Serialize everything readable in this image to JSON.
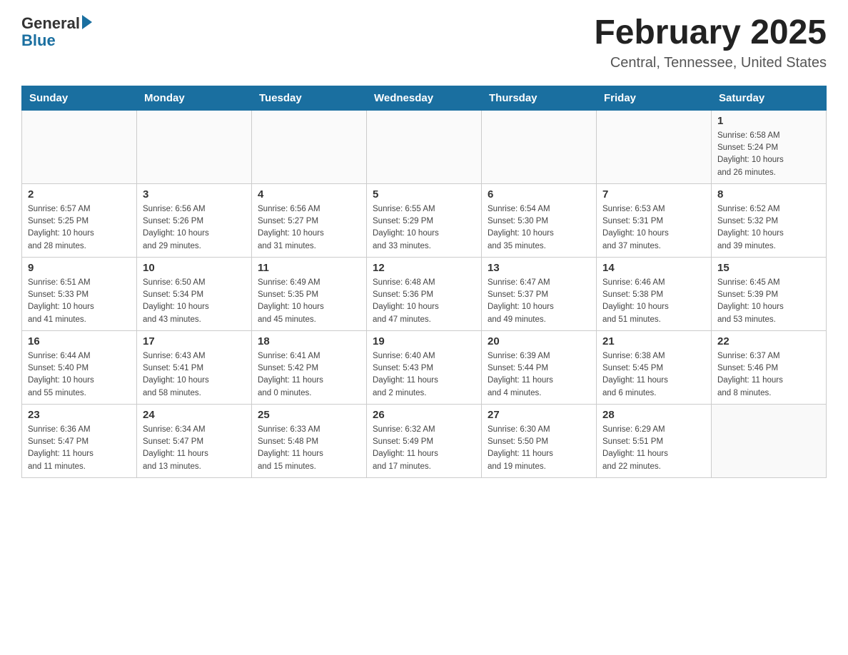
{
  "header": {
    "logo_general": "General",
    "logo_blue": "Blue",
    "month_title": "February 2025",
    "location": "Central, Tennessee, United States"
  },
  "days_of_week": [
    "Sunday",
    "Monday",
    "Tuesday",
    "Wednesday",
    "Thursday",
    "Friday",
    "Saturday"
  ],
  "weeks": [
    [
      {
        "day": "",
        "info": ""
      },
      {
        "day": "",
        "info": ""
      },
      {
        "day": "",
        "info": ""
      },
      {
        "day": "",
        "info": ""
      },
      {
        "day": "",
        "info": ""
      },
      {
        "day": "",
        "info": ""
      },
      {
        "day": "1",
        "info": "Sunrise: 6:58 AM\nSunset: 5:24 PM\nDaylight: 10 hours\nand 26 minutes."
      }
    ],
    [
      {
        "day": "2",
        "info": "Sunrise: 6:57 AM\nSunset: 5:25 PM\nDaylight: 10 hours\nand 28 minutes."
      },
      {
        "day": "3",
        "info": "Sunrise: 6:56 AM\nSunset: 5:26 PM\nDaylight: 10 hours\nand 29 minutes."
      },
      {
        "day": "4",
        "info": "Sunrise: 6:56 AM\nSunset: 5:27 PM\nDaylight: 10 hours\nand 31 minutes."
      },
      {
        "day": "5",
        "info": "Sunrise: 6:55 AM\nSunset: 5:29 PM\nDaylight: 10 hours\nand 33 minutes."
      },
      {
        "day": "6",
        "info": "Sunrise: 6:54 AM\nSunset: 5:30 PM\nDaylight: 10 hours\nand 35 minutes."
      },
      {
        "day": "7",
        "info": "Sunrise: 6:53 AM\nSunset: 5:31 PM\nDaylight: 10 hours\nand 37 minutes."
      },
      {
        "day": "8",
        "info": "Sunrise: 6:52 AM\nSunset: 5:32 PM\nDaylight: 10 hours\nand 39 minutes."
      }
    ],
    [
      {
        "day": "9",
        "info": "Sunrise: 6:51 AM\nSunset: 5:33 PM\nDaylight: 10 hours\nand 41 minutes."
      },
      {
        "day": "10",
        "info": "Sunrise: 6:50 AM\nSunset: 5:34 PM\nDaylight: 10 hours\nand 43 minutes."
      },
      {
        "day": "11",
        "info": "Sunrise: 6:49 AM\nSunset: 5:35 PM\nDaylight: 10 hours\nand 45 minutes."
      },
      {
        "day": "12",
        "info": "Sunrise: 6:48 AM\nSunset: 5:36 PM\nDaylight: 10 hours\nand 47 minutes."
      },
      {
        "day": "13",
        "info": "Sunrise: 6:47 AM\nSunset: 5:37 PM\nDaylight: 10 hours\nand 49 minutes."
      },
      {
        "day": "14",
        "info": "Sunrise: 6:46 AM\nSunset: 5:38 PM\nDaylight: 10 hours\nand 51 minutes."
      },
      {
        "day": "15",
        "info": "Sunrise: 6:45 AM\nSunset: 5:39 PM\nDaylight: 10 hours\nand 53 minutes."
      }
    ],
    [
      {
        "day": "16",
        "info": "Sunrise: 6:44 AM\nSunset: 5:40 PM\nDaylight: 10 hours\nand 55 minutes."
      },
      {
        "day": "17",
        "info": "Sunrise: 6:43 AM\nSunset: 5:41 PM\nDaylight: 10 hours\nand 58 minutes."
      },
      {
        "day": "18",
        "info": "Sunrise: 6:41 AM\nSunset: 5:42 PM\nDaylight: 11 hours\nand 0 minutes."
      },
      {
        "day": "19",
        "info": "Sunrise: 6:40 AM\nSunset: 5:43 PM\nDaylight: 11 hours\nand 2 minutes."
      },
      {
        "day": "20",
        "info": "Sunrise: 6:39 AM\nSunset: 5:44 PM\nDaylight: 11 hours\nand 4 minutes."
      },
      {
        "day": "21",
        "info": "Sunrise: 6:38 AM\nSunset: 5:45 PM\nDaylight: 11 hours\nand 6 minutes."
      },
      {
        "day": "22",
        "info": "Sunrise: 6:37 AM\nSunset: 5:46 PM\nDaylight: 11 hours\nand 8 minutes."
      }
    ],
    [
      {
        "day": "23",
        "info": "Sunrise: 6:36 AM\nSunset: 5:47 PM\nDaylight: 11 hours\nand 11 minutes."
      },
      {
        "day": "24",
        "info": "Sunrise: 6:34 AM\nSunset: 5:47 PM\nDaylight: 11 hours\nand 13 minutes."
      },
      {
        "day": "25",
        "info": "Sunrise: 6:33 AM\nSunset: 5:48 PM\nDaylight: 11 hours\nand 15 minutes."
      },
      {
        "day": "26",
        "info": "Sunrise: 6:32 AM\nSunset: 5:49 PM\nDaylight: 11 hours\nand 17 minutes."
      },
      {
        "day": "27",
        "info": "Sunrise: 6:30 AM\nSunset: 5:50 PM\nDaylight: 11 hours\nand 19 minutes."
      },
      {
        "day": "28",
        "info": "Sunrise: 6:29 AM\nSunset: 5:51 PM\nDaylight: 11 hours\nand 22 minutes."
      },
      {
        "day": "",
        "info": ""
      }
    ]
  ]
}
